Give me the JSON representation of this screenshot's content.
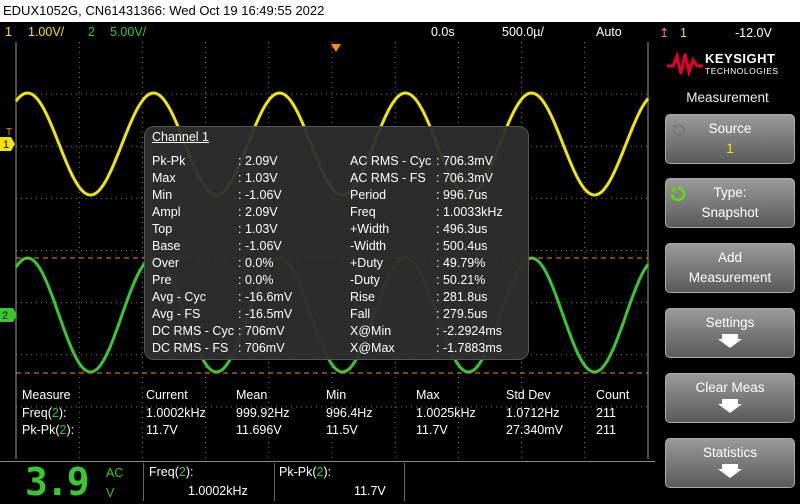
{
  "title_bar": "EDUX1052G, CN61431366: Wed Oct 19 16:49:55 2022",
  "status": {
    "ch1_num": "1",
    "ch1_scale": "1.00V/",
    "ch2_num": "2",
    "ch2_scale": "5.00V/",
    "delay": "0.0s",
    "timebase": "500.0µ/",
    "trigger_mode": "Auto",
    "trigger_num": "1",
    "trigger_level": "-12.0V"
  },
  "markers": {
    "ch1": "1",
    "ch2": "2",
    "trig": "T"
  },
  "popup": {
    "title": "Channel 1",
    "left": [
      {
        "label": "Pk-Pk",
        "value": ": 2.09V"
      },
      {
        "label": "Max",
        "value": ": 1.03V"
      },
      {
        "label": "Min",
        "value": ": -1.06V"
      },
      {
        "label": "Ampl",
        "value": ": 2.09V"
      },
      {
        "label": "Top",
        "value": ": 1.03V"
      },
      {
        "label": "Base",
        "value": ": -1.06V"
      },
      {
        "label": "Over",
        "value": ": 0.0%"
      },
      {
        "label": "Pre",
        "value": ": 0.0%"
      },
      {
        "label": "Avg - Cyc",
        "value": ": -16.6mV"
      },
      {
        "label": "Avg - FS",
        "value": ": -16.5mV"
      },
      {
        "label": "DC RMS - Cyc",
        "value": ": 706mV"
      },
      {
        "label": "DC RMS - FS",
        "value": ": 706mV"
      }
    ],
    "right": [
      {
        "label": "AC RMS - Cyc",
        "value": ": 706.3mV"
      },
      {
        "label": "AC RMS - FS",
        "value": ": 706.3mV"
      },
      {
        "label": "Period",
        "value": ": 996.7us"
      },
      {
        "label": "Freq",
        "value": ": 1.0033kHz"
      },
      {
        "label": "+Width",
        "value": ": 496.3us"
      },
      {
        "label": "-Width",
        "value": ": 500.4us"
      },
      {
        "label": "+Duty",
        "value": ": 49.79%"
      },
      {
        "label": "-Duty",
        "value": ": 50.21%"
      },
      {
        "label": "Rise",
        "value": ": 281.8us"
      },
      {
        "label": "Fall",
        "value": ": 279.5us"
      },
      {
        "label": "X@Min",
        "value": ": -2.2924ms"
      },
      {
        "label": "X@Max",
        "value": ": -1.7883ms"
      }
    ]
  },
  "measure_table": {
    "headers": [
      "Measure",
      "Current",
      "Mean",
      "Min",
      "Max",
      "Std Dev",
      "Count"
    ],
    "rows": [
      {
        "name_pre": "Freq(",
        "name_ch": "2",
        "name_post": "):",
        "cells": [
          "1.0002kHz",
          "999.92Hz",
          "996.4Hz",
          "1.0025kHz",
          "1.0712Hz",
          "211"
        ]
      },
      {
        "name_pre": "Pk-Pk(",
        "name_ch": "2",
        "name_post": "):",
        "cells": [
          "11.7V",
          "11.696V",
          "11.5V",
          "11.7V",
          "27.340mV",
          "211"
        ]
      }
    ]
  },
  "sidebar": {
    "brand": "KEYSIGHT",
    "brand_sub": "TECHNOLOGIES",
    "menu_title": "Measurement",
    "keys": [
      {
        "l1": "Source",
        "l2": "1"
      },
      {
        "l1": "Type:",
        "l2": "Snapshot"
      },
      {
        "l1": "Add",
        "l2": "Measurement"
      },
      {
        "l1": "Settings"
      },
      {
        "l1": "Clear Meas"
      },
      {
        "l1": "Statistics"
      }
    ]
  },
  "bottom": {
    "big_digit": "3.9",
    "coupling": "AC",
    "unit": "V",
    "m1_pre": "Freq(",
    "m1_ch": "2",
    "m1_post": "):",
    "m1_value": "1.0002kHz",
    "m2_pre": "Pk-Pk(",
    "m2_ch": "2",
    "m2_post": "):",
    "m2_value": "11.7V"
  },
  "colors": {
    "ch1": "#f2e600",
    "ch2": "#38c830",
    "trigger": "#ff8c00",
    "grid": "#808080"
  }
}
